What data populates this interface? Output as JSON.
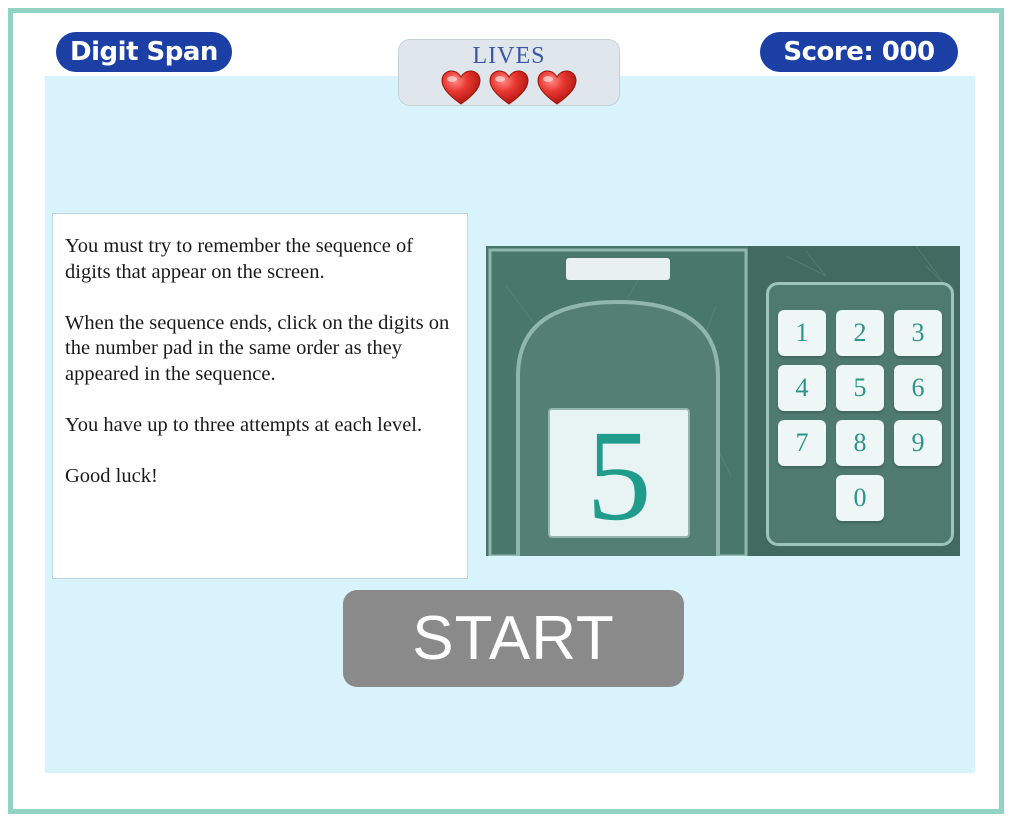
{
  "header": {
    "title": "Digit Span",
    "lives_label": "LIVES",
    "lives": 3,
    "score_text": "Score: 000"
  },
  "instructions": {
    "paragraphs": [
      "You must try to remember the sequence of digits that appear on the screen.",
      "When the sequence ends, click on the digits on the number pad in the same order as they appeared in the sequence.",
      "You have up to three attempts at each level.",
      "Good luck!"
    ]
  },
  "preview": {
    "displayed_digit": "5",
    "keypad_keys": [
      "1",
      "2",
      "3",
      "4",
      "5",
      "6",
      "7",
      "8",
      "9",
      "0"
    ]
  },
  "start_label": "START",
  "colors": {
    "frame_border": "#93d3c6",
    "play_area": "#d9f3fc",
    "pill": "#1c3fa6",
    "heart": "#e0312e",
    "start_button": "#8a8a8a",
    "panel_dark": "#426a60",
    "key_text": "#2c9488"
  },
  "icons": {
    "heart": "heart-icon"
  }
}
